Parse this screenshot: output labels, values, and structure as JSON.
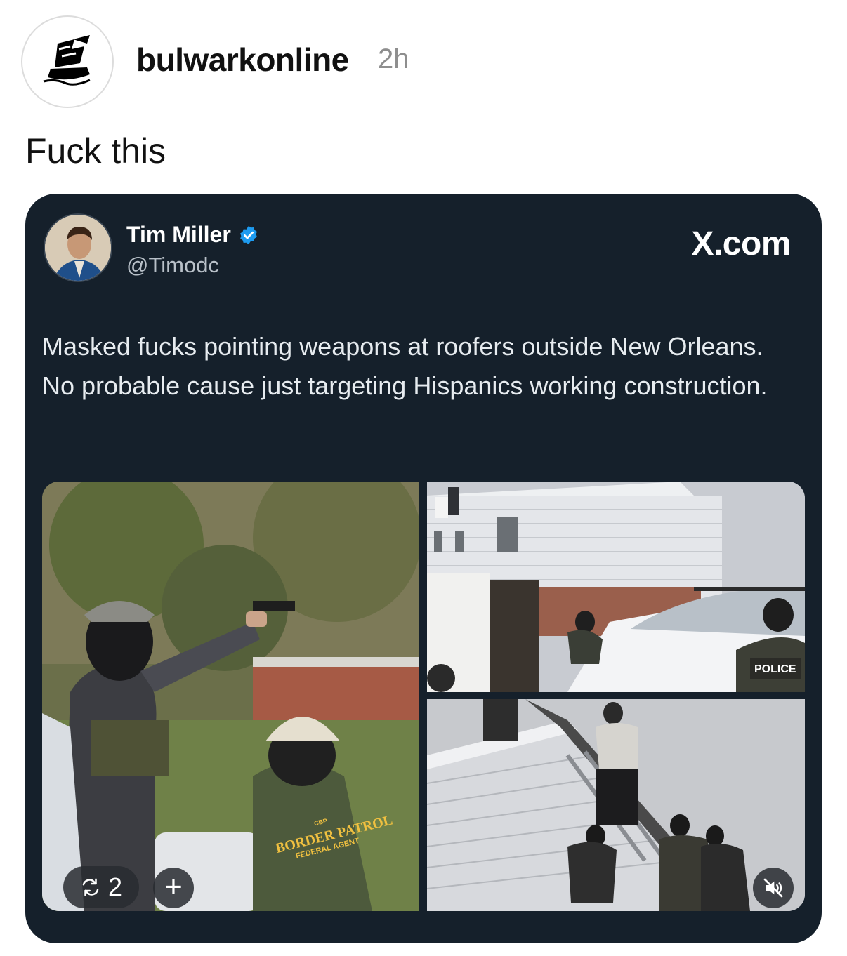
{
  "post": {
    "username": "bulwarkonline",
    "time": "2h",
    "caption": "Fuck this"
  },
  "embed": {
    "author_name": "Tim Miller",
    "handle": "@Timodc",
    "source": "X.com",
    "text": "Masked fucks pointing weapons at roofers outside New Orleans. No probable cause just targeting Hispanics working construction.",
    "verified_color": "#1d9bf0",
    "card_bg": "#15202b"
  },
  "media": {
    "patch_text_1": "BORDER PATROL",
    "patch_text_2": "FEDERAL AGENT",
    "patch_text_3": "CBP",
    "police_label": "POLICE",
    "repost_count": "2",
    "plus_label": "+"
  },
  "icons": [
    "ship-logo-icon",
    "verified-badge-icon",
    "repost-icon",
    "muted-speaker-icon"
  ]
}
